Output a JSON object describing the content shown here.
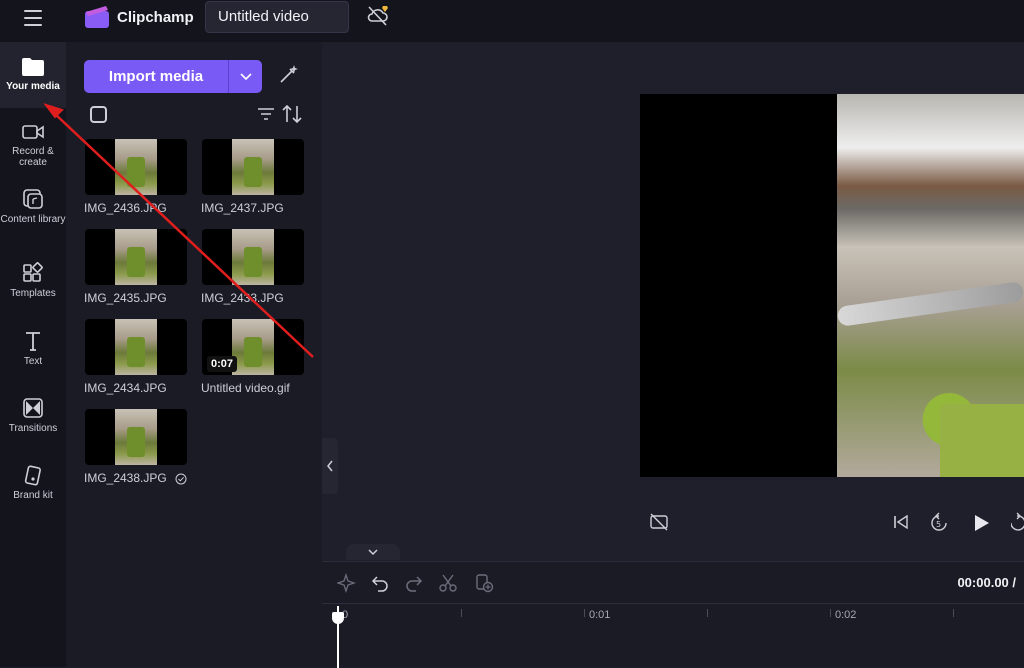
{
  "header": {
    "app_name": "Clipchamp",
    "project_title": "Untitled video"
  },
  "sidebar": {
    "items": [
      {
        "label": "Your media",
        "icon": "folder-icon"
      },
      {
        "label": "Record & create",
        "icon": "video-camera-icon"
      },
      {
        "label": "Content library",
        "icon": "content-library-icon"
      },
      {
        "label": "Templates",
        "icon": "templates-icon"
      },
      {
        "label": "Text",
        "icon": "text-icon"
      },
      {
        "label": "Transitions",
        "icon": "transitions-icon"
      },
      {
        "label": "Brand kit",
        "icon": "brand-kit-icon"
      }
    ]
  },
  "media_panel": {
    "import_label": "Import media",
    "items": [
      {
        "name": "IMG_2436.JPG"
      },
      {
        "name": "IMG_2437.JPG"
      },
      {
        "name": "IMG_2435.JPG"
      },
      {
        "name": "IMG_2433.JPG"
      },
      {
        "name": "IMG_2434.JPG"
      },
      {
        "name": "Untitled video.gif",
        "duration": "0:07"
      },
      {
        "name": "IMG_2438.JPG"
      }
    ]
  },
  "timeline": {
    "timecode": "00:00.00 /",
    "ruler_labels": [
      "0",
      "0:01",
      "0:02"
    ]
  },
  "colors": {
    "accent": "#7a5af5",
    "annotation_arrow": "#e01e1e"
  }
}
